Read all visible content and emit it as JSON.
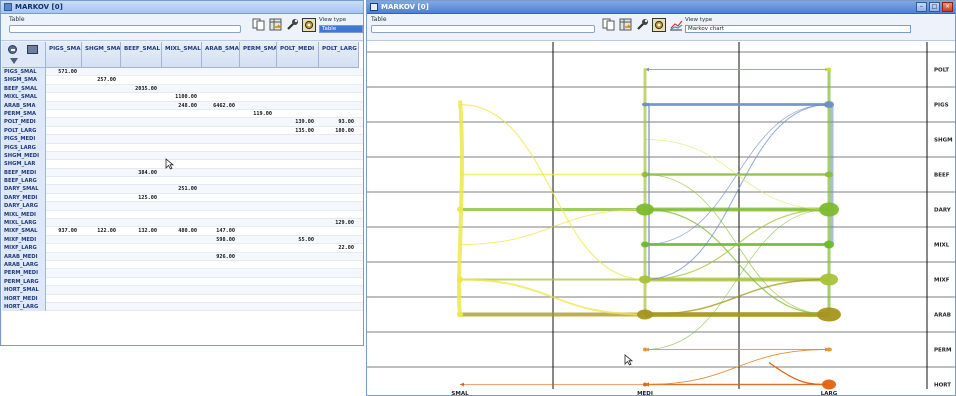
{
  "table_window": {
    "title": "MARKOV [0]",
    "toolbar": {
      "table_label": "Table",
      "view_type_label": "View type",
      "view_type_value": "Table"
    },
    "columns": [
      "PIGS_SMAL",
      "SHGM_SMAL",
      "BEEF_SMAL",
      "MIXL_SMAL",
      "ARAB_SMAL",
      "PERM_SMAL",
      "POLT_MEDI",
      "POLT_LARG"
    ],
    "rows": [
      {
        "label": "PIGS_SMAL",
        "cells": [
          "571.00",
          "",
          "",
          "",
          "",
          "",
          "",
          ""
        ]
      },
      {
        "label": "SHGM_SMA",
        "cells": [
          "",
          "257.00",
          "",
          "",
          "",
          "",
          "",
          ""
        ]
      },
      {
        "label": "BEEF_SMAL",
        "cells": [
          "",
          "",
          "2035.00",
          "",
          "",
          "",
          "",
          ""
        ]
      },
      {
        "label": "MIXL_SMAL",
        "cells": [
          "",
          "",
          "",
          "1100.00",
          "",
          "",
          "",
          ""
        ]
      },
      {
        "label": "ARAB_SMA",
        "cells": [
          "",
          "",
          "",
          "248.00",
          "6462.00",
          "",
          "",
          ""
        ]
      },
      {
        "label": "PERM_SMA",
        "cells": [
          "",
          "",
          "",
          "",
          "",
          "119.00",
          "",
          ""
        ]
      },
      {
        "label": "POLT_MEDI",
        "cells": [
          "",
          "",
          "",
          "",
          "",
          "",
          "139.00",
          "93.00"
        ]
      },
      {
        "label": "POLT_LARG",
        "cells": [
          "",
          "",
          "",
          "",
          "",
          "",
          "135.00",
          "180.00"
        ]
      },
      {
        "label": "PIGS_MEDI",
        "cells": [
          "",
          "",
          "",
          "",
          "",
          "",
          "",
          ""
        ]
      },
      {
        "label": "PIGS_LARG",
        "cells": [
          "",
          "",
          "",
          "",
          "",
          "",
          "",
          ""
        ]
      },
      {
        "label": "SHGM_MEDI",
        "cells": [
          "",
          "",
          "",
          "",
          "",
          "",
          "",
          ""
        ]
      },
      {
        "label": "SHGM_LAR",
        "cells": [
          "",
          "",
          "",
          "",
          "",
          "",
          "",
          ""
        ]
      },
      {
        "label": "BEEF_MEDI",
        "cells": [
          "",
          "",
          "384.00",
          "",
          "",
          "",
          "",
          ""
        ]
      },
      {
        "label": "BEEF_LARG",
        "cells": [
          "",
          "",
          "",
          "",
          "",
          "",
          "",
          ""
        ]
      },
      {
        "label": "DARY_SMAL",
        "cells": [
          "",
          "",
          "",
          "251.00",
          "",
          "",
          "",
          ""
        ]
      },
      {
        "label": "DARY_MEDI",
        "cells": [
          "",
          "",
          "125.00",
          "",
          "",
          "",
          "",
          ""
        ]
      },
      {
        "label": "DARY_LARG",
        "cells": [
          "",
          "",
          "",
          "",
          "",
          "",
          "",
          ""
        ]
      },
      {
        "label": "MIXL_MEDI",
        "cells": [
          "",
          "",
          "",
          "",
          "",
          "",
          "",
          ""
        ]
      },
      {
        "label": "MIXL_LARG",
        "cells": [
          "",
          "",
          "",
          "",
          "",
          "",
          "",
          "129.00"
        ]
      },
      {
        "label": "MIXF_SMAL",
        "cells": [
          "937.00",
          "122.00",
          "132.00",
          "480.00",
          "147.00",
          "",
          "",
          ""
        ]
      },
      {
        "label": "MIXF_MEDI",
        "cells": [
          "",
          "",
          "",
          "",
          "598.00",
          "",
          "55.00",
          ""
        ]
      },
      {
        "label": "MIXF_LARG",
        "cells": [
          "",
          "",
          "",
          "",
          "",
          "",
          "",
          "22.00"
        ]
      },
      {
        "label": "ARAB_MEDI",
        "cells": [
          "",
          "",
          "",
          "",
          "926.00",
          "",
          "",
          ""
        ]
      },
      {
        "label": "ARAB_LARG",
        "cells": [
          "",
          "",
          "",
          "",
          "",
          "",
          "",
          ""
        ]
      },
      {
        "label": "PERM_MEDI",
        "cells": [
          "",
          "",
          "",
          "",
          "",
          "",
          "",
          ""
        ]
      },
      {
        "label": "PERM_LARG",
        "cells": [
          "",
          "",
          "",
          "",
          "",
          "",
          "",
          ""
        ]
      },
      {
        "label": "HORT_SMAL",
        "cells": [
          "",
          "",
          "",
          "",
          "",
          "",
          "",
          ""
        ]
      },
      {
        "label": "HORT_MEDI",
        "cells": [
          "",
          "",
          "",
          "",
          "",
          "",
          "",
          ""
        ]
      },
      {
        "label": "HORT_LARG",
        "cells": [
          "",
          "",
          "",
          "",
          "",
          "",
          "",
          ""
        ]
      }
    ]
  },
  "chart_window": {
    "title": "MARKOV [0]",
    "toolbar": {
      "table_label": "Table",
      "view_type_label": "View type",
      "view_type_value": "Markov chart"
    }
  },
  "chart_data": {
    "type": "markov-flow",
    "columns": [
      "SMAL",
      "MEDI",
      "LARG"
    ],
    "categories": [
      "POLT",
      "PIGS",
      "SHGM",
      "BEEF",
      "DARY",
      "MIXL",
      "MIXF",
      "ARAB",
      "PERM",
      "HORT"
    ],
    "colors": {
      "POLT": "#c9d83b",
      "PIGS": "#6f8fc4",
      "SHGM": "#dfe56a",
      "BEEF": "#8cbf3a",
      "DARY": "#7dbb2e",
      "MIXL": "#69b92a",
      "MIXF": "#a9c23b",
      "ARAB": "#a6951e",
      "PERM": "#e8902f",
      "HORT": "#e2620f",
      "SMAL": "#ece74a"
    }
  }
}
